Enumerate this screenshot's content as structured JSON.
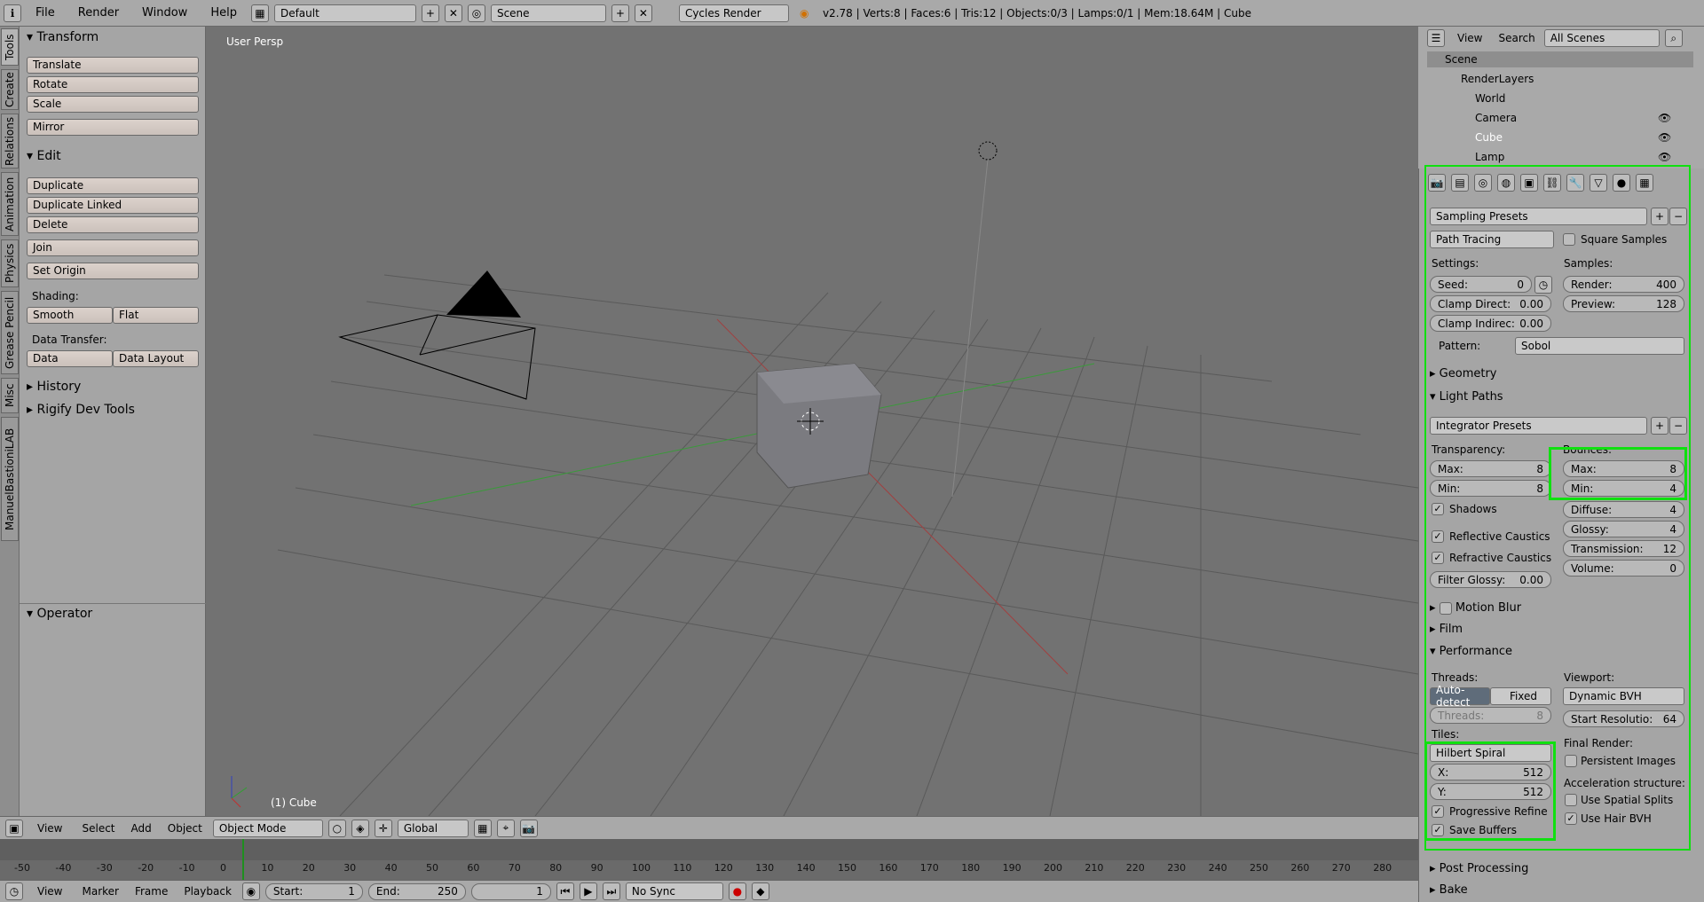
{
  "topbar": {
    "menus": [
      "File",
      "Render",
      "Window",
      "Help"
    ],
    "layout": "Default",
    "scene": "Scene",
    "engine": "Cycles Render",
    "stats": "v2.78 | Verts:8 | Faces:6 | Tris:12 | Objects:0/3 | Lamps:0/1 | Mem:18.64M | Cube"
  },
  "vtabs": [
    "Tools",
    "Create",
    "Relations",
    "Animation",
    "Physics",
    "Grease Pencil",
    "Misc",
    "ManuelBastioniLAB"
  ],
  "tools": {
    "transform_title": "Transform",
    "translate": "Translate",
    "rotate": "Rotate",
    "scale": "Scale",
    "mirror": "Mirror",
    "edit_title": "Edit",
    "duplicate": "Duplicate",
    "duplicate_linked": "Duplicate Linked",
    "delete": "Delete",
    "join": "Join",
    "set_origin": "Set Origin",
    "shading_label": "Shading:",
    "smooth": "Smooth",
    "flat": "Flat",
    "data_transfer_label": "Data Transfer:",
    "data": "Data",
    "data_layout": "Data Layout",
    "history": "History",
    "rigify": "Rigify Dev Tools",
    "operator": "Operator"
  },
  "viewport": {
    "view_label": "User Persp",
    "object_label": "(1) Cube"
  },
  "outliner": {
    "view": "View",
    "search": "Search",
    "scenes": "All Scenes",
    "items": [
      "Scene",
      "RenderLayers",
      "World",
      "Camera",
      "Cube",
      "Lamp"
    ]
  },
  "render": {
    "sampling_presets": "Sampling Presets",
    "path_tracing": "Path Tracing",
    "square_samples": "Square Samples",
    "settings_label": "Settings:",
    "samples_label": "Samples:",
    "seed_label": "Seed:",
    "seed_value": "0",
    "render_label": "Render:",
    "render_value": "400",
    "clamp_direct": "Clamp Direct:",
    "clamp_direct_value": "0.00",
    "preview_label": "Preview:",
    "preview_value": "128",
    "clamp_indirect": "Clamp Indirec:",
    "clamp_indirect_value": "0.00",
    "pattern_label": "Pattern:",
    "pattern_value": "Sobol",
    "geometry": "Geometry",
    "light_paths": "Light Paths",
    "integrator_presets": "Integrator Presets",
    "transparency_label": "Transparency:",
    "bounces_label": "Bounces:",
    "max_label": "Max:",
    "t_max": "8",
    "min_label": "Min:",
    "t_min": "8",
    "b_max": "8",
    "b_min": "4",
    "shadows": "Shadows",
    "diffuse_label": "Diffuse:",
    "diffuse": "4",
    "reflective": "Reflective Caustics",
    "glossy_label": "Glossy:",
    "glossy": "4",
    "refractive": "Refractive Caustics",
    "transmission_label": "Transmission:",
    "transmission": "12",
    "filter_glossy": "Filter Glossy:",
    "filter_glossy_value": "0.00",
    "volume_label": "Volume:",
    "volume": "0",
    "motion_blur": "Motion Blur",
    "film": "Film",
    "performance": "Performance",
    "threads_label": "Threads:",
    "viewport_label": "Viewport:",
    "auto_detect": "Auto-detect",
    "fixed": "Fixed",
    "dynamic_bvh": "Dynamic BVH",
    "threads_field": "Threads:",
    "threads_value": "8",
    "start_res": "Start Resolutio:",
    "start_res_value": "64",
    "tiles_label": "Tiles:",
    "final_render_label": "Final Render:",
    "hilbert": "Hilbert Spiral",
    "persistent": "Persistent Images",
    "x_label": "X:",
    "x_value": "512",
    "accel_label": "Acceleration structure:",
    "y_label": "Y:",
    "y_value": "512",
    "spatial_splits": "Use Spatial Splits",
    "progressive_refine": "Progressive Refine",
    "hair_bvh": "Use Hair BVH",
    "save_buffers": "Save Buffers",
    "post_processing": "Post Processing",
    "bake": "Bake"
  },
  "view3d_header": {
    "menus": [
      "View",
      "Select",
      "Add",
      "Object"
    ],
    "mode": "Object Mode",
    "orientation": "Global"
  },
  "timeline": {
    "ticks": [
      "-50",
      "-40",
      "-30",
      "-20",
      "-10",
      "0",
      "10",
      "20",
      "30",
      "40",
      "50",
      "60",
      "70",
      "80",
      "90",
      "100",
      "110",
      "120",
      "130",
      "140",
      "150",
      "160",
      "170",
      "180",
      "190",
      "200",
      "210",
      "220",
      "230",
      "240",
      "250",
      "260",
      "270",
      "280"
    ],
    "menus": [
      "View",
      "Marker",
      "Frame",
      "Playback"
    ],
    "start_label": "Start:",
    "start": "1",
    "end_label": "End:",
    "end": "250",
    "current": "1",
    "sync": "No Sync"
  }
}
